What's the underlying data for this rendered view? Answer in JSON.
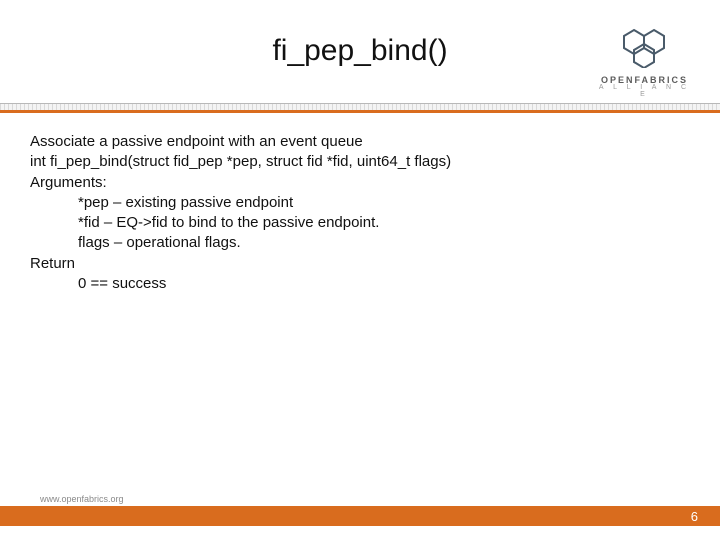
{
  "title": "fi_pep_bind()",
  "logo": {
    "brand": "OPENFABRICS",
    "subtitle": "A L L I A N C E"
  },
  "content": {
    "description": "Associate a passive endpoint with an event queue",
    "signature": "int fi_pep_bind(struct fid_pep *pep, struct fid *fid, uint64_t flags)",
    "arguments_label": "Arguments:",
    "arguments": [
      "*pep – existing passive endpoint",
      "*fid – EQ->fid to bind to the passive endpoint.",
      "flags – operational flags."
    ],
    "return_label": "Return",
    "return_value": "0 == success"
  },
  "footer": {
    "url": "www.openfabrics.org",
    "page": "6"
  }
}
